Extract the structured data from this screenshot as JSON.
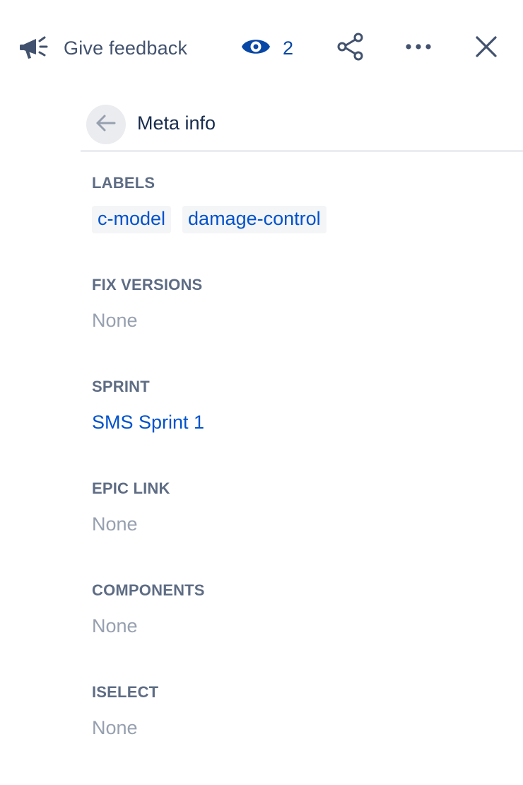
{
  "toolbar": {
    "feedback_label": "Give feedback",
    "watch_count": "2",
    "icons": [
      "megaphone-icon",
      "eye-icon",
      "share-icon",
      "more-icon",
      "close-icon"
    ]
  },
  "meta": {
    "title": "Meta info",
    "back_icon": "arrow-left-icon"
  },
  "fields": [
    {
      "label": "LABELS",
      "values": [
        "c-model",
        "damage-control"
      ]
    },
    {
      "label": "FIX VERSIONS",
      "value": "None"
    },
    {
      "label": "SPRINT",
      "value": "SMS Sprint 1"
    },
    {
      "label": "EPIC LINK",
      "value": "None"
    },
    {
      "label": "COMPONENTS",
      "value": "None"
    },
    {
      "label": "ISELECT",
      "value": "None"
    }
  ],
  "colors": {
    "link": "#0052cc",
    "watch": "#0747a6",
    "muted": "#97a0af",
    "label": "#5e6c84",
    "icon": "#42526e"
  }
}
